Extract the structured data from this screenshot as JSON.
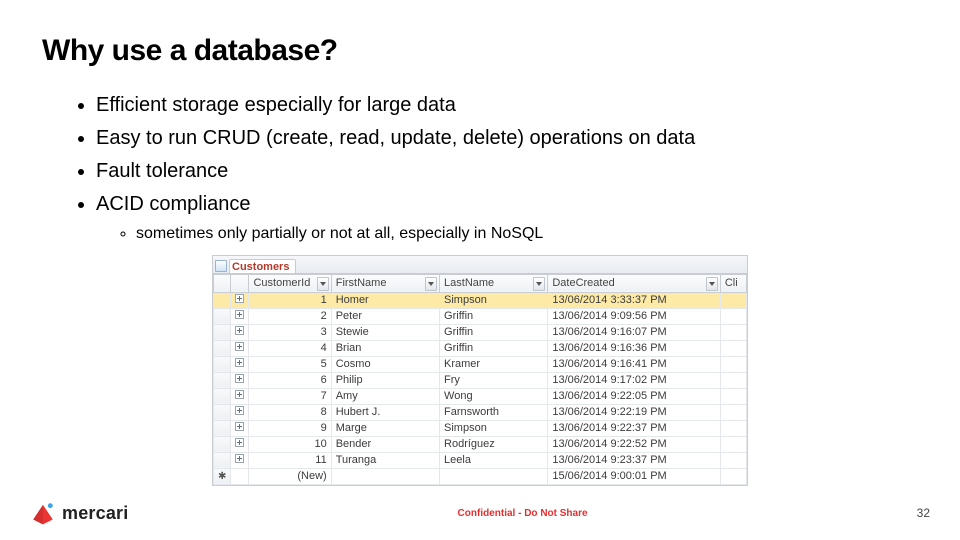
{
  "title": "Why use a database?",
  "bullets": [
    "Efficient storage especially for large data",
    "Easy to run CRUD (create, read, update, delete) operations on data",
    "Fault tolerance",
    "ACID compliance"
  ],
  "sub_bullet": "sometimes only partially or not at all, especially in NoSQL",
  "table": {
    "tab_label": "Customers",
    "headers": {
      "id": "CustomerId",
      "first": "FirstName",
      "last": "LastName",
      "date": "DateCreated",
      "cli": "Cli"
    },
    "rows": [
      {
        "id": "1",
        "first": "Homer",
        "last": "Simpson",
        "date": "13/06/2014 3:33:37 PM",
        "selected": true
      },
      {
        "id": "2",
        "first": "Peter",
        "last": "Griffin",
        "date": "13/06/2014 9:09:56 PM",
        "selected": false
      },
      {
        "id": "3",
        "first": "Stewie",
        "last": "Griffin",
        "date": "13/06/2014 9:16:07 PM",
        "selected": false
      },
      {
        "id": "4",
        "first": "Brian",
        "last": "Griffin",
        "date": "13/06/2014 9:16:36 PM",
        "selected": false
      },
      {
        "id": "5",
        "first": "Cosmo",
        "last": "Kramer",
        "date": "13/06/2014 9:16:41 PM",
        "selected": false
      },
      {
        "id": "6",
        "first": "Philip",
        "last": "Fry",
        "date": "13/06/2014 9:17:02 PM",
        "selected": false
      },
      {
        "id": "7",
        "first": "Amy",
        "last": "Wong",
        "date": "13/06/2014 9:22:05 PM",
        "selected": false
      },
      {
        "id": "8",
        "first": "Hubert J.",
        "last": "Farnsworth",
        "date": "13/06/2014 9:22:19 PM",
        "selected": false
      },
      {
        "id": "9",
        "first": "Marge",
        "last": "Simpson",
        "date": "13/06/2014 9:22:37 PM",
        "selected": false
      },
      {
        "id": "10",
        "first": "Bender",
        "last": "Rodríguez",
        "date": "13/06/2014 9:22:52 PM",
        "selected": false
      },
      {
        "id": "11",
        "first": "Turanga",
        "last": "Leela",
        "date": "13/06/2014 9:23:37 PM",
        "selected": false
      }
    ],
    "new_row": {
      "label": "(New)",
      "date": "15/06/2014 9:00:01 PM"
    }
  },
  "footer": {
    "brand": "mercari",
    "confidential": "Confidential - Do Not Share",
    "page": "32"
  }
}
